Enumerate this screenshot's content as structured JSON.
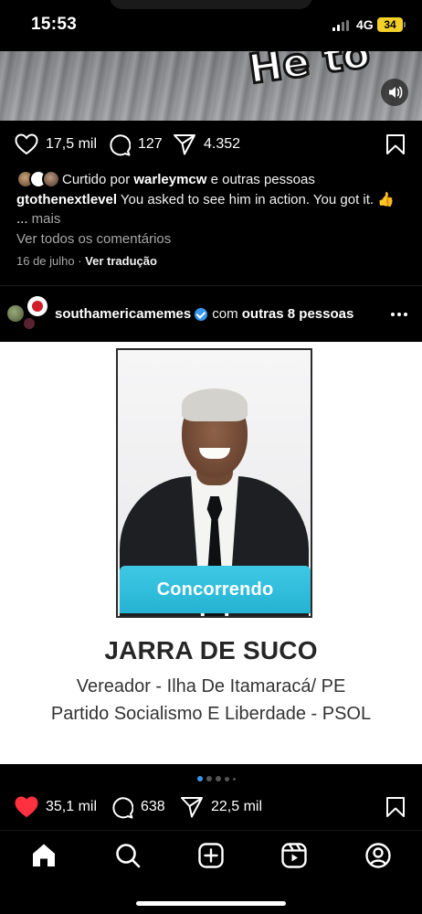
{
  "status_bar": {
    "time": "15:53",
    "network": "4G",
    "battery": "34"
  },
  "previous_post": {
    "overlay_text": "He to",
    "likes": "17,5 mil",
    "comments": "127",
    "shares": "4.352",
    "liked_by_prefix": "Curtido por ",
    "liked_by_user": "warleymcw",
    "liked_by_suffix": " e outras pessoas",
    "caption_user": "gtothenextlevel",
    "caption_text": " You asked to see him in action. You got it. 👍 ...",
    "caption_more": " mais",
    "view_comments": "Ver todos os comentários",
    "date": "16 de julho",
    "date_sep": " · ",
    "translate": "Ver tradução"
  },
  "post_header": {
    "username": "southamericamemes",
    "with_text": "com",
    "others": " outras 8 pessoas"
  },
  "post_media": {
    "badge": "Concorrendo",
    "candidate_name": "JARRA DE SUCO",
    "role": "Vereador - Ilha De Itamaracá/ PE",
    "party": "Partido Socialismo E Liberdade - PSOL",
    "carousel_index": 1,
    "carousel_count": 5,
    "badge_color": "#2fbddc"
  },
  "current_post": {
    "likes": "35,1 mil",
    "liked": true,
    "comments": "638",
    "shares": "22,5 mil",
    "like_color": "#ff3040"
  },
  "bottom_nav": {
    "items": [
      "home-icon",
      "search-icon",
      "create-icon",
      "reels-icon",
      "profile-icon"
    ],
    "active": "home-icon"
  }
}
